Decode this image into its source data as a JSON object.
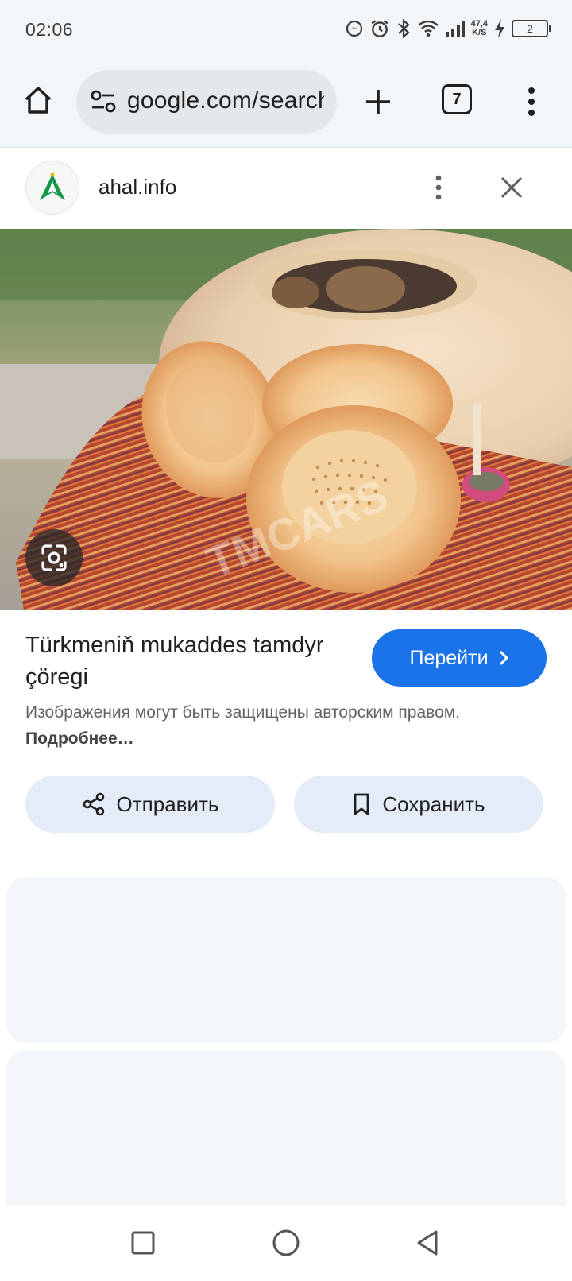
{
  "status_bar": {
    "time": "02:06",
    "net_speed_value": "47,4",
    "net_speed_unit": "K/S",
    "battery_level": "2"
  },
  "browser": {
    "url": "google.com/search",
    "tab_count": "7"
  },
  "site": {
    "name": "ahal.info",
    "logo_icon": "ahal-logo-icon"
  },
  "result": {
    "title": "Türkmeniň mukaddes tamdyr çöregi",
    "visit_label": "Перейти",
    "copyright_notice": "Изображения могут быть защищены авторским правом.",
    "more_link": "Подробнее…"
  },
  "actions": {
    "share_label": "Отправить",
    "save_label": "Сохранить"
  },
  "colors": {
    "accent": "#1a73e8",
    "action_bg": "#e3ecf7",
    "toolbar_bg": "#f3f6f9"
  }
}
